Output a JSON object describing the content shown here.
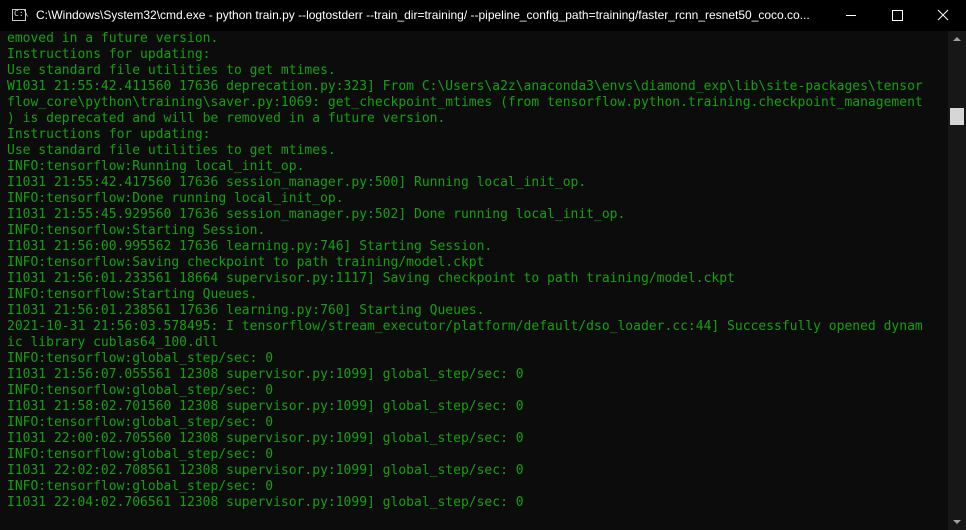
{
  "window": {
    "title": "C:\\Windows\\System32\\cmd.exe - python  train.py --logtostderr --train_dir=training/ --pipeline_config_path=training/faster_rcnn_resnet50_coco.co...",
    "icon": "cmd-icon",
    "controls": [
      "minimize-icon",
      "maximize-icon",
      "close-icon"
    ]
  },
  "colors": {
    "text": "#13a10e",
    "background": "#0c0c0c",
    "titlebar": "#000000"
  },
  "console": {
    "lines": [
      "emoved in a future version.",
      "Instructions for updating:",
      "Use standard file utilities to get mtimes.",
      "W1031 21:55:42.411560 17636 deprecation.py:323] From C:\\Users\\a2z\\anaconda3\\envs\\diamond_exp\\lib\\site-packages\\tensor",
      "flow_core\\python\\training\\saver.py:1069: get_checkpoint_mtimes (from tensorflow.python.training.checkpoint_management",
      ") is deprecated and will be removed in a future version.",
      "Instructions for updating:",
      "Use standard file utilities to get mtimes.",
      "INFO:tensorflow:Running local_init_op.",
      "I1031 21:55:42.417560 17636 session_manager.py:500] Running local_init_op.",
      "INFO:tensorflow:Done running local_init_op.",
      "I1031 21:55:45.929560 17636 session_manager.py:502] Done running local_init_op.",
      "INFO:tensorflow:Starting Session.",
      "I1031 21:56:00.995562 17636 learning.py:746] Starting Session.",
      "INFO:tensorflow:Saving checkpoint to path training/model.ckpt",
      "I1031 21:56:01.233561 18664 supervisor.py:1117] Saving checkpoint to path training/model.ckpt",
      "INFO:tensorflow:Starting Queues.",
      "I1031 21:56:01.238561 17636 learning.py:760] Starting Queues.",
      "2021-10-31 21:56:03.578495: I tensorflow/stream_executor/platform/default/dso_loader.cc:44] Successfully opened dynam",
      "ic library cublas64_100.dll",
      "INFO:tensorflow:global_step/sec: 0",
      "I1031 21:56:07.055561 12308 supervisor.py:1099] global_step/sec: 0",
      "INFO:tensorflow:global_step/sec: 0",
      "I1031 21:58:02.701560 12308 supervisor.py:1099] global_step/sec: 0",
      "INFO:tensorflow:global_step/sec: 0",
      "I1031 22:00:02.705560 12308 supervisor.py:1099] global_step/sec: 0",
      "INFO:tensorflow:global_step/sec: 0",
      "I1031 22:02:02.708561 12308 supervisor.py:1099] global_step/sec: 0",
      "INFO:tensorflow:global_step/sec: 0",
      "I1031 22:04:02.706561 12308 supervisor.py:1099] global_step/sec: 0"
    ]
  }
}
